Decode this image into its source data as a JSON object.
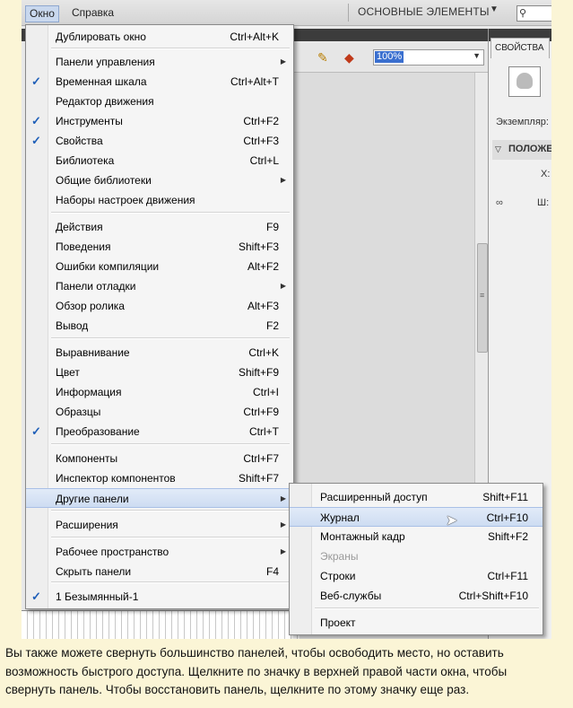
{
  "menubar": {
    "window_label": "Окно",
    "help_label": "Справка",
    "workspace_label": "ОСНОВНЫЕ ЭЛЕМЕНТЫ",
    "workspace_arrow": "▼",
    "search_icon": "⚲"
  },
  "toolbar": {
    "zoom_value": "100%",
    "zoom_arrow": "▼"
  },
  "properties_panel": {
    "tab_label": "СВОЙСТВА",
    "instance_label": "Экземпляр:",
    "position_section": "ПОЛОЖЕ",
    "position_chevron": "▽",
    "x_label": "X:",
    "width_label": "Ш:",
    "link_icon": "∞"
  },
  "window_menu": {
    "items": [
      {
        "label": "Дублировать окно",
        "shortcut": "Ctrl+Alt+K",
        "check": "",
        "submenu": ""
      },
      {
        "label": "Панели управления",
        "shortcut": "",
        "check": "",
        "submenu": "▶"
      },
      {
        "label": "Временная шкала",
        "shortcut": "Ctrl+Alt+T",
        "check": "✓",
        "submenu": ""
      },
      {
        "label": "Редактор движения",
        "shortcut": "",
        "check": "",
        "submenu": ""
      },
      {
        "label": "Инструменты",
        "shortcut": "Ctrl+F2",
        "check": "✓",
        "submenu": ""
      },
      {
        "label": "Свойства",
        "shortcut": "Ctrl+F3",
        "check": "✓",
        "submenu": ""
      },
      {
        "label": "Библиотека",
        "shortcut": "Ctrl+L",
        "check": "",
        "submenu": ""
      },
      {
        "label": "Общие библиотеки",
        "shortcut": "",
        "check": "",
        "submenu": "▶"
      },
      {
        "label": "Наборы настроек движения",
        "shortcut": "",
        "check": "",
        "submenu": ""
      },
      {
        "label": "Действия",
        "shortcut": "F9",
        "check": "",
        "submenu": ""
      },
      {
        "label": "Поведения",
        "shortcut": "Shift+F3",
        "check": "",
        "submenu": ""
      },
      {
        "label": "Ошибки компиляции",
        "shortcut": "Alt+F2",
        "check": "",
        "submenu": ""
      },
      {
        "label": "Панели отладки",
        "shortcut": "",
        "check": "",
        "submenu": "▶"
      },
      {
        "label": "Обзор ролика",
        "shortcut": "Alt+F3",
        "check": "",
        "submenu": ""
      },
      {
        "label": "Вывод",
        "shortcut": "F2",
        "check": "",
        "submenu": ""
      },
      {
        "label": "Выравнивание",
        "shortcut": "Ctrl+K",
        "check": "",
        "submenu": ""
      },
      {
        "label": "Цвет",
        "shortcut": "Shift+F9",
        "check": "",
        "submenu": ""
      },
      {
        "label": "Информация",
        "shortcut": "Ctrl+I",
        "check": "",
        "submenu": ""
      },
      {
        "label": "Образцы",
        "shortcut": "Ctrl+F9",
        "check": "",
        "submenu": ""
      },
      {
        "label": "Преобразование",
        "shortcut": "Ctrl+T",
        "check": "✓",
        "submenu": ""
      },
      {
        "label": "Компоненты",
        "shortcut": "Ctrl+F7",
        "check": "",
        "submenu": ""
      },
      {
        "label": "Инспектор компонентов",
        "shortcut": "Shift+F7",
        "check": "",
        "submenu": ""
      },
      {
        "label": "Другие панели",
        "shortcut": "",
        "check": "",
        "submenu": "▶"
      },
      {
        "label": "Расширения",
        "shortcut": "",
        "check": "",
        "submenu": "▶"
      },
      {
        "label": "Рабочее пространство",
        "shortcut": "",
        "check": "",
        "submenu": "▶"
      },
      {
        "label": "Скрыть панели",
        "shortcut": "F4",
        "check": "",
        "submenu": ""
      },
      {
        "label": "1 Безымянный-1",
        "shortcut": "",
        "check": "✓",
        "submenu": ""
      }
    ]
  },
  "other_panels_submenu": {
    "items": [
      {
        "label": "Расширенный доступ",
        "shortcut": "Shift+F11"
      },
      {
        "label": "Журнал",
        "shortcut": "Ctrl+F10"
      },
      {
        "label": "Монтажный кадр",
        "shortcut": "Shift+F2"
      },
      {
        "label": "Экраны",
        "shortcut": ""
      },
      {
        "label": "Строки",
        "shortcut": "Ctrl+F11"
      },
      {
        "label": "Веб-службы",
        "shortcut": "Ctrl+Shift+F10"
      },
      {
        "label": "Проект",
        "shortcut": ""
      }
    ]
  },
  "caption": {
    "line1": "Вы также можете свернуть большинство панелей, чтобы освободить место, но оставить",
    "line2": "возможность быстрого доступа. Щелкните по значку в верхней правой части окна, чтобы",
    "line3": "свернуть панель. Чтобы восстановить панель, щелкните по этому значку еще раз."
  }
}
